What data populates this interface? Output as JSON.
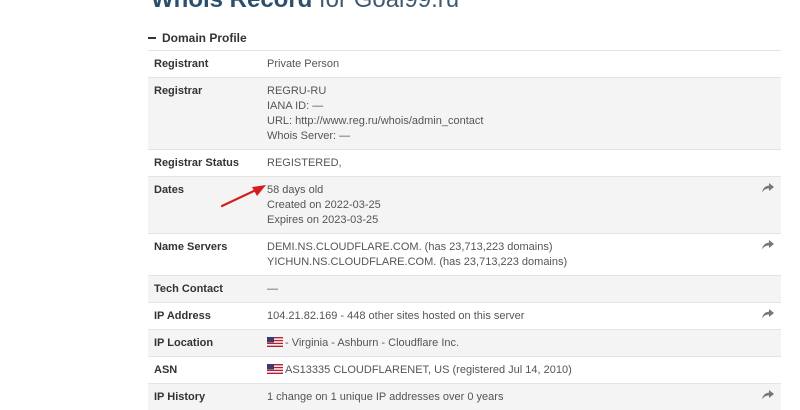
{
  "header": {
    "title_main": "Whois Record",
    "title_suffix": "for Goal99.ru"
  },
  "section": {
    "label": "Domain Profile"
  },
  "rows": {
    "registrant": {
      "label": "Registrant",
      "lines": [
        "Private Person"
      ]
    },
    "registrar": {
      "label": "Registrar",
      "lines": [
        "REGRU-RU",
        "IANA ID: —",
        "URL: http://www.reg.ru/whois/admin_contact",
        "Whois Server: —"
      ]
    },
    "registrar_status": {
      "label": "Registrar Status",
      "lines": [
        "REGISTERED,"
      ]
    },
    "dates": {
      "label": "Dates",
      "lines": [
        "58 days old",
        "Created on 2022-03-25",
        "Expires on 2023-03-25"
      ]
    },
    "name_servers": {
      "label": "Name Servers",
      "lines": [
        "DEMI.NS.CLOUDFLARE.COM. (has 23,713,223 domains)",
        "YICHUN.NS.CLOUDFLARE.COM. (has 23,713,223 domains)"
      ]
    },
    "tech_contact": {
      "label": "Tech Contact",
      "lines": [
        "—"
      ]
    },
    "ip_address": {
      "label": "IP Address",
      "lines": [
        "104.21.82.169 - 448 other sites hosted on this server"
      ]
    },
    "ip_location": {
      "label": "IP Location",
      "lines": [
        "- Virginia - Ashburn - Cloudflare Inc."
      ]
    },
    "asn": {
      "label": "ASN",
      "lines": [
        "AS13335 CLOUDFLARENET, US (registered Jul 14, 2010)"
      ]
    },
    "ip_history": {
      "label": "IP History",
      "lines": [
        "1 change on 1 unique IP addresses over 0 years"
      ]
    }
  },
  "icons": {
    "share": "share-arrow-icon",
    "flag": "us-flag-icon",
    "collapse": "minus-icon"
  },
  "colors": {
    "title": "#2b4f6e",
    "annotation_arrow": "#d11f1f",
    "row_alt": "#f4f4f4"
  }
}
